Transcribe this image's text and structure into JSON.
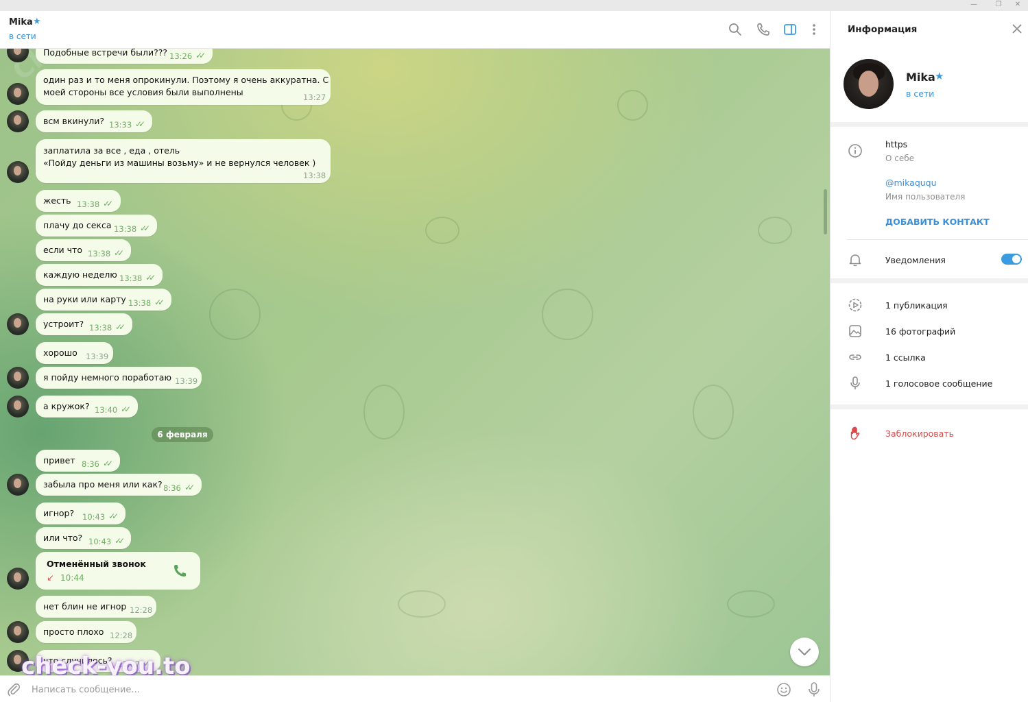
{
  "window": {
    "minimize": "—",
    "restore": "❐",
    "close": "✕"
  },
  "header": {
    "name": "Mika",
    "star": "★",
    "status": "в сети",
    "icons": [
      "search-icon",
      "phone-icon",
      "sidebar-toggle-icon",
      "more-vert-icon"
    ]
  },
  "messages": [
    {
      "text": "Подобные встречи были???",
      "time": "13:26",
      "checks": "✓✓"
    },
    {
      "text": "один раз и то меня опрокинули. Поэтому я очень аккуратна. С",
      "text2": "моей стороны все условия были выполнены",
      "time": "13:27"
    },
    {
      "text": "всм вкинули?",
      "time": "13:33",
      "checks": "✓✓"
    },
    {
      "text": "заплатила за все , еда , отель",
      "text2": "«Пойду деньги из машины возьму» и не вернулся человек )",
      "time": "13:38"
    },
    {
      "text": "жесть",
      "time": "13:38",
      "checks": "✓✓"
    },
    {
      "text": "плачу до секса",
      "time": "13:38",
      "checks": "✓✓"
    },
    {
      "text": "если что",
      "time": "13:38",
      "checks": "✓✓"
    },
    {
      "text": "каждую неделю",
      "time": "13:38",
      "checks": "✓✓"
    },
    {
      "text": "на руки или карту",
      "time": "13:38",
      "checks": "✓✓"
    },
    {
      "text": "устроит?",
      "time": "13:38",
      "checks": "✓✓"
    },
    {
      "text": "хорошо",
      "time": "13:39"
    },
    {
      "text": "я пойду немного поработаю",
      "time": "13:39"
    },
    {
      "text": "а кружок?",
      "time": "13:40",
      "checks": "✓✓"
    },
    {
      "text": "привет",
      "time": "8:36",
      "checks": "✓✓"
    },
    {
      "text": "забыла про меня или как?",
      "time": "8:36",
      "checks": "✓✓"
    },
    {
      "text": "игнор?",
      "time": "10:43",
      "checks": "✓✓"
    },
    {
      "text": "или что?",
      "time": "10:43",
      "checks": "✓✓"
    },
    {
      "text": "нет блин не игнор",
      "time": "12:28"
    },
    {
      "text": "просто плохо",
      "time": "12:28"
    },
    {
      "text": "что случилось?",
      "time": "13:07",
      "checks": "✓✓"
    }
  ],
  "date_separator": "6 февраля",
  "call": {
    "title": "Отменённый звонок",
    "time": "10:44",
    "arrow": "↙"
  },
  "watermark": "check-you.to",
  "watermark_diag": "CHECK-YOU.ME",
  "composer": {
    "placeholder": "Написать сообщение..."
  },
  "info": {
    "title": "Информация",
    "name": "Mika",
    "star": "★",
    "status": "в сети",
    "bio": "https",
    "bio_label": "О себе",
    "username": "@mikaququ",
    "username_label": "Имя пользователя",
    "add_contact": "ДОБАВИТЬ КОНТАКТ",
    "notifications": "Уведомления",
    "notifications_on": true,
    "media": [
      "1 публикация",
      "16 фотографий",
      "1 ссылка",
      "1 голосовое сообщение"
    ],
    "block": "Заблокировать"
  },
  "colors": {
    "accent": "#3a9be0",
    "bubble": "#f5fbe9",
    "time_green": "#6fae63",
    "danger": "#d64a4a"
  }
}
